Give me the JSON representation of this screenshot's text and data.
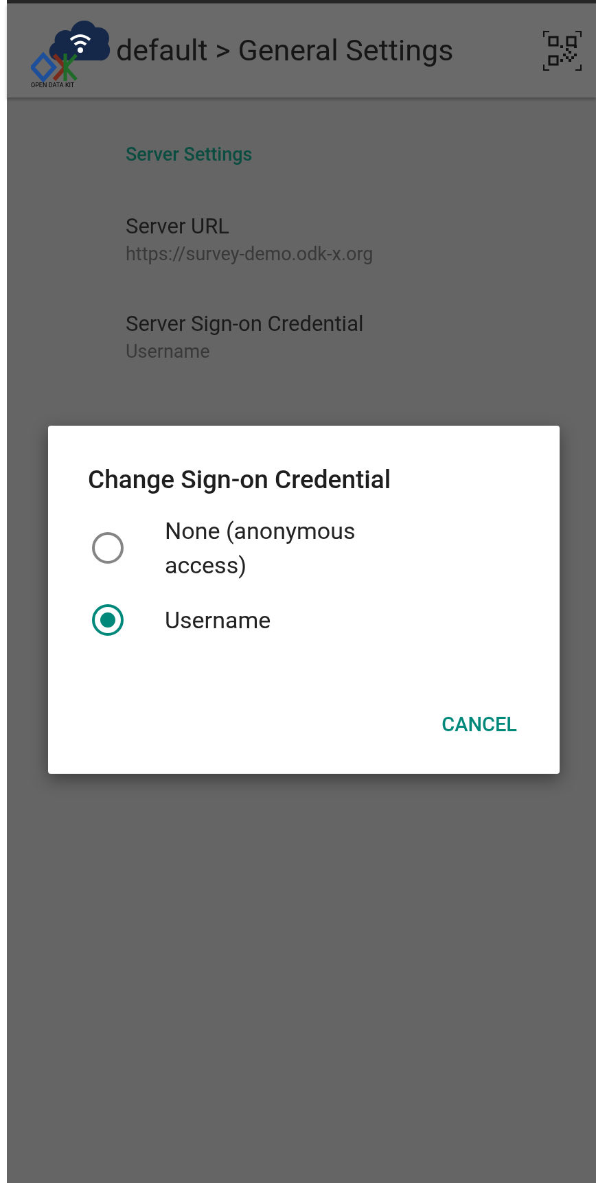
{
  "app_bar": {
    "logo_caption": "OPEN DATA KIT",
    "title": "default > General Settings"
  },
  "settings": {
    "section_title": "Server Settings",
    "items": [
      {
        "title": "Server URL",
        "summary": "https://survey-demo.odk-x.org"
      },
      {
        "title": "Server Sign-on Credential",
        "summary": "Username"
      }
    ]
  },
  "dialog": {
    "title": "Change Sign-on Credential",
    "options": [
      {
        "label": "None (anonymous access)",
        "selected": false
      },
      {
        "label": "Username",
        "selected": true
      }
    ],
    "buttons": [
      "CANCEL"
    ]
  }
}
